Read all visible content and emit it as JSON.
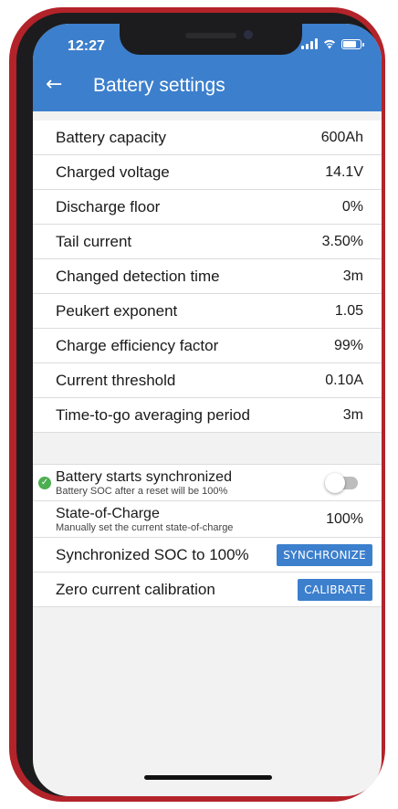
{
  "status": {
    "time": "12:27"
  },
  "appbar": {
    "title": "Battery settings",
    "back_icon": "back-arrow-icon"
  },
  "settings": [
    {
      "label": "Battery capacity",
      "value": "600Ah"
    },
    {
      "label": "Charged voltage",
      "value": "14.1V"
    },
    {
      "label": "Discharge floor",
      "value": "0%"
    },
    {
      "label": "Tail current",
      "value": "3.50%"
    },
    {
      "label": "Changed detection time",
      "value": "3m"
    },
    {
      "label": "Peukert exponent",
      "value": "1.05"
    },
    {
      "label": "Charge efficiency factor",
      "value": "99%"
    },
    {
      "label": "Current threshold",
      "value": "0.10A"
    },
    {
      "label": "Time-to-go averaging period",
      "value": "3m"
    }
  ],
  "sync_start": {
    "label": "Battery starts synchronized",
    "sublabel": "Battery SOC after a reset will be 100%",
    "enabled": false
  },
  "soc": {
    "label": "State-of-Charge",
    "sublabel": "Manually set the current state-of-charge",
    "value": "100%"
  },
  "sync": {
    "label": "Synchronized SOC to 100%",
    "button": "SYNCHRONIZE"
  },
  "calib": {
    "label": "Zero current calibration",
    "button": "CALIBRATE"
  },
  "colors": {
    "accent": "#3c7fcd",
    "frame": "#b3232a",
    "check": "#4caf50"
  }
}
